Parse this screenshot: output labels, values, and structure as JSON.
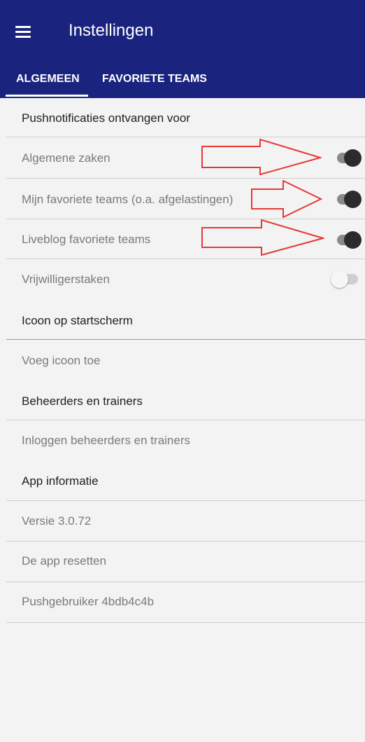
{
  "appbar": {
    "title": "Instellingen",
    "tabs": [
      {
        "label": "ALGEMEEN",
        "active": true
      },
      {
        "label": "FAVORIETE TEAMS",
        "active": false
      }
    ]
  },
  "sections": {
    "push": {
      "title": "Pushnotificaties ontvangen voor",
      "items": [
        {
          "label": "Algemene zaken",
          "enabled": true
        },
        {
          "label": "Mijn favoriete teams (o.a. afgelastingen)",
          "enabled": true
        },
        {
          "label": "Liveblog favoriete teams",
          "enabled": true
        },
        {
          "label": "Vrijwilligerstaken",
          "enabled": false
        }
      ]
    },
    "icon": {
      "title": "Icoon op startscherm",
      "items": [
        {
          "label": "Voeg icoon toe"
        }
      ]
    },
    "admin": {
      "title": "Beheerders en trainers",
      "items": [
        {
          "label": "Inloggen beheerders en trainers"
        }
      ]
    },
    "info": {
      "title": "App informatie",
      "items": [
        {
          "label": "Versie 3.0.72"
        },
        {
          "label": "De app resetten"
        },
        {
          "label": "Pushgebruiker 4bdb4c4b"
        }
      ]
    }
  },
  "colors": {
    "appbar": "#1a237e",
    "annotation": "#e53935",
    "switch_on": "#2b2b2b"
  },
  "icons": {
    "menu": "hamburger-menu-icon"
  }
}
